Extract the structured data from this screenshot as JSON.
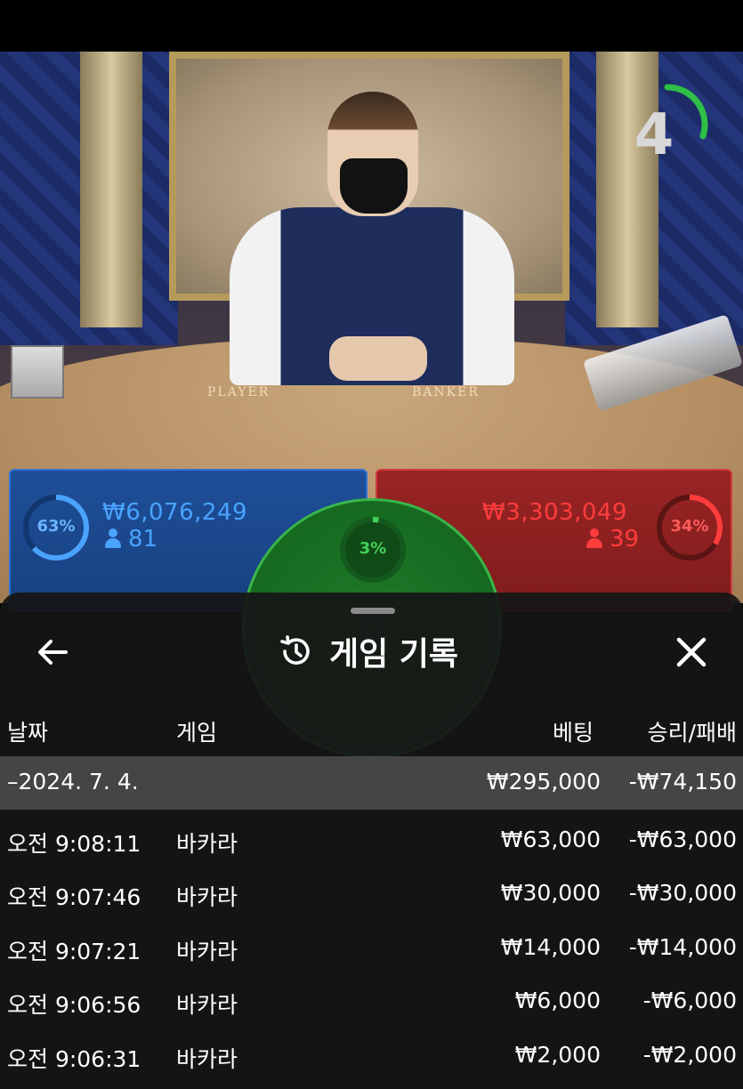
{
  "timer": {
    "value": "4",
    "progress": 0.3
  },
  "table_labels": {
    "player": "PLAYER",
    "banker": "BANKER"
  },
  "colors": {
    "player": "#2f72d6",
    "banker": "#d33a3a",
    "tie": "#39b54a"
  },
  "bets": {
    "player": {
      "percent": "63%",
      "percent_value": 63,
      "amount": "₩6,076,249",
      "players": "81"
    },
    "tie": {
      "percent": "3%",
      "percent_value": 3
    },
    "banker": {
      "percent": "34%",
      "percent_value": 34,
      "amount": "₩3,303,049",
      "players": "39"
    }
  },
  "history_sheet": {
    "title": "게임 기록",
    "icons": {
      "back": "arrow-left-icon",
      "history": "history-icon",
      "close": "close-icon"
    },
    "columns": {
      "date": "날짜",
      "game": "게임",
      "bet": "베팅",
      "result": "승리/패배"
    },
    "date_group": {
      "label": "–2024. 7. 4.",
      "bet": "₩295,000",
      "result": "-₩74,150"
    },
    "rows": [
      {
        "time": "오전 9:08:11",
        "game": "바카라",
        "bet": "₩63,000",
        "result": "-₩63,000"
      },
      {
        "time": "오전 9:07:46",
        "game": "바카라",
        "bet": "₩30,000",
        "result": "-₩30,000"
      },
      {
        "time": "오전 9:07:21",
        "game": "바카라",
        "bet": "₩14,000",
        "result": "-₩14,000"
      },
      {
        "time": "오전 9:06:56",
        "game": "바카라",
        "bet": "₩6,000",
        "result": "-₩6,000"
      },
      {
        "time": "오전 9:06:31",
        "game": "바카라",
        "bet": "₩2,000",
        "result": "-₩2,000"
      }
    ]
  }
}
